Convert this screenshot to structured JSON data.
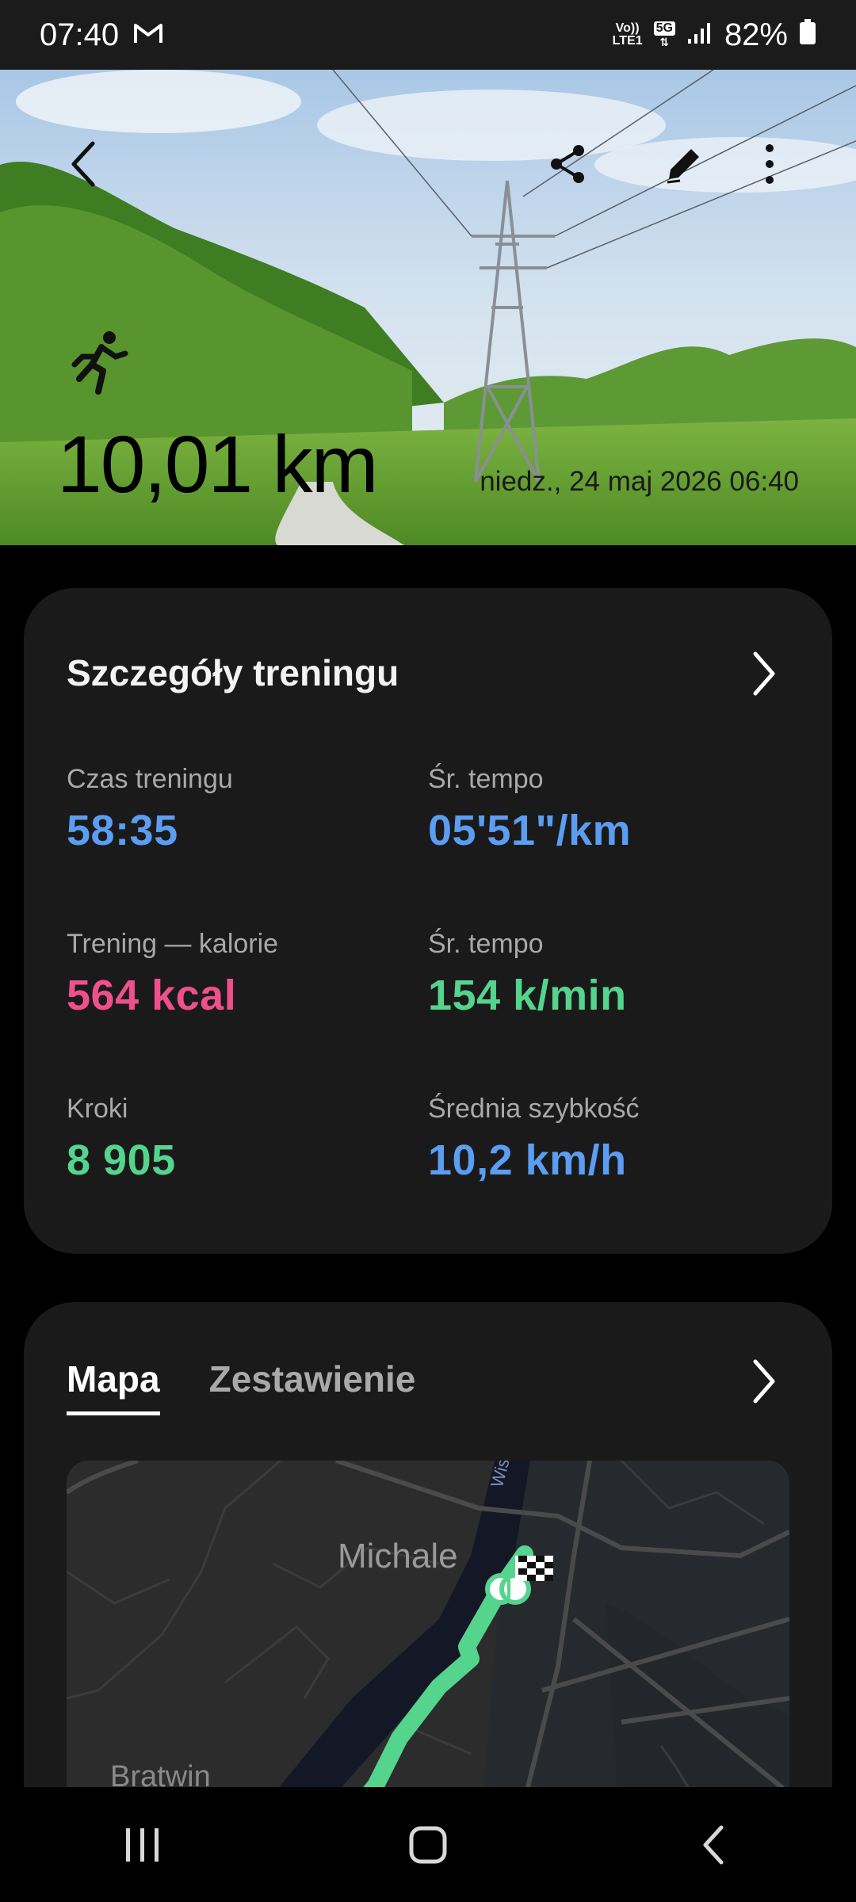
{
  "status_bar": {
    "time": "07:40",
    "volte_line1": "Vo))",
    "volte_line2": "LTE1",
    "network_badge": "5G",
    "battery": "82%",
    "icons": [
      "gmail-icon",
      "volte-icon",
      "5g-icon",
      "signal-icon",
      "battery-icon"
    ]
  },
  "hero": {
    "distance": "10,01 km",
    "datetime": "niedz., 24 maj 2026 06:40",
    "icons": [
      "back-icon",
      "share-icon",
      "edit-icon",
      "more-icon",
      "running-icon"
    ]
  },
  "details_card": {
    "title": "Szczegóły treningu",
    "stats": [
      {
        "label": "Czas treningu",
        "value": "58:35",
        "color": "#5b9df0"
      },
      {
        "label": "Śr. tempo",
        "value": "05'51\"/km",
        "color": "#5b9df0"
      },
      {
        "label": "Trening — kalorie",
        "value": "564 kcal",
        "color": "#f0508a"
      },
      {
        "label": "Śr. tempo",
        "value": "154 k/min",
        "color": "#54d48c"
      },
      {
        "label": "Kroki",
        "value": "8 905",
        "color": "#54d48c"
      },
      {
        "label": "Średnia szybkość",
        "value": "10,2 km/h",
        "color": "#5b9df0"
      }
    ]
  },
  "map_card": {
    "tabs": [
      {
        "label": "Mapa",
        "active": true
      },
      {
        "label": "Zestawienie",
        "active": false
      }
    ],
    "map_labels": {
      "place1": "Michale",
      "place2": "Bratwin",
      "river": "Wisła"
    },
    "route_color": "#54d48c"
  },
  "nav_bar": {
    "icons": [
      "recent-apps-icon",
      "home-icon",
      "back-nav-icon"
    ]
  }
}
